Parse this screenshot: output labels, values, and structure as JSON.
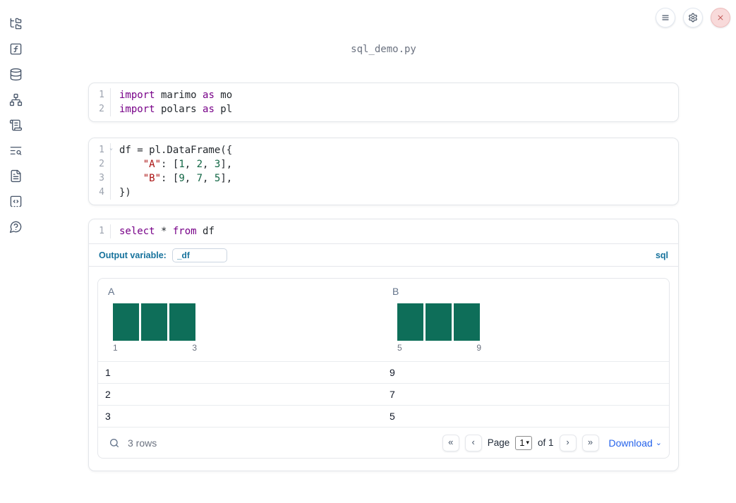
{
  "window": {
    "title": "sql_demo.py"
  },
  "sidebar": {
    "icons": [
      "file-tree",
      "function-square",
      "database",
      "dependency-graph",
      "scroll-logs",
      "text-search",
      "file-document",
      "code-snippets",
      "help-question"
    ]
  },
  "topbar": {
    "buttons": [
      "menu",
      "settings",
      "close"
    ]
  },
  "colors": {
    "keyword": "#770088",
    "string": "#aa1111",
    "number": "#116644",
    "accent_label": "#16729c",
    "histogram_bar": "#0e6e59",
    "link": "#2563eb"
  },
  "cells": [
    {
      "lines": [
        {
          "no": "1",
          "tokens": [
            {
              "t": "kw",
              "v": "import"
            },
            {
              "t": "pl",
              "v": " marimo "
            },
            {
              "t": "kw",
              "v": "as"
            },
            {
              "t": "pl",
              "v": " mo"
            }
          ]
        },
        {
          "no": "2",
          "tokens": [
            {
              "t": "kw",
              "v": "import"
            },
            {
              "t": "pl",
              "v": " polars "
            },
            {
              "t": "kw",
              "v": "as"
            },
            {
              "t": "pl",
              "v": " pl"
            }
          ]
        }
      ]
    },
    {
      "lines": [
        {
          "no": "1",
          "fold": "⌄",
          "tokens": [
            {
              "t": "pl",
              "v": "df = pl.DataFrame({"
            }
          ]
        },
        {
          "no": "2",
          "tokens": [
            {
              "t": "pl",
              "v": "    "
            },
            {
              "t": "str",
              "v": "\"A\""
            },
            {
              "t": "pl",
              "v": ": ["
            },
            {
              "t": "num",
              "v": "1"
            },
            {
              "t": "pl",
              "v": ", "
            },
            {
              "t": "num",
              "v": "2"
            },
            {
              "t": "pl",
              "v": ", "
            },
            {
              "t": "num",
              "v": "3"
            },
            {
              "t": "pl",
              "v": "],"
            }
          ]
        },
        {
          "no": "3",
          "tokens": [
            {
              "t": "pl",
              "v": "    "
            },
            {
              "t": "str",
              "v": "\"B\""
            },
            {
              "t": "pl",
              "v": ": ["
            },
            {
              "t": "num",
              "v": "9"
            },
            {
              "t": "pl",
              "v": ", "
            },
            {
              "t": "num",
              "v": "7"
            },
            {
              "t": "pl",
              "v": ", "
            },
            {
              "t": "num",
              "v": "5"
            },
            {
              "t": "pl",
              "v": "],"
            }
          ]
        },
        {
          "no": "4",
          "tokens": [
            {
              "t": "pl",
              "v": "})"
            }
          ]
        }
      ]
    },
    {
      "lines": [
        {
          "no": "1",
          "tokens": [
            {
              "t": "kw",
              "v": "select"
            },
            {
              "t": "pl",
              "v": " * "
            },
            {
              "t": "kw",
              "v": "from"
            },
            {
              "t": "pl",
              "v": " df"
            }
          ]
        }
      ],
      "output_variable": {
        "label": "Output variable:",
        "value": "_df"
      },
      "language_badge": "sql"
    }
  ],
  "table": {
    "columns": [
      {
        "header": "A",
        "hist": {
          "bars": [
            1,
            1,
            1
          ],
          "tick_left": "1",
          "tick_right": "3"
        }
      },
      {
        "header": "B",
        "hist": {
          "bars": [
            1,
            1,
            1
          ],
          "tick_left": "5",
          "tick_right": "9"
        }
      }
    ],
    "rows": [
      [
        "1",
        "9"
      ],
      [
        "2",
        "7"
      ],
      [
        "3",
        "5"
      ]
    ],
    "footer": {
      "row_count": "3 rows",
      "first_page": "«",
      "prev_page": "‹",
      "next_page": "›",
      "last_page": "»",
      "page_label": "Page",
      "page_value": "1",
      "of_label": "of 1",
      "download_label": "Download",
      "caret": "⌄"
    }
  }
}
